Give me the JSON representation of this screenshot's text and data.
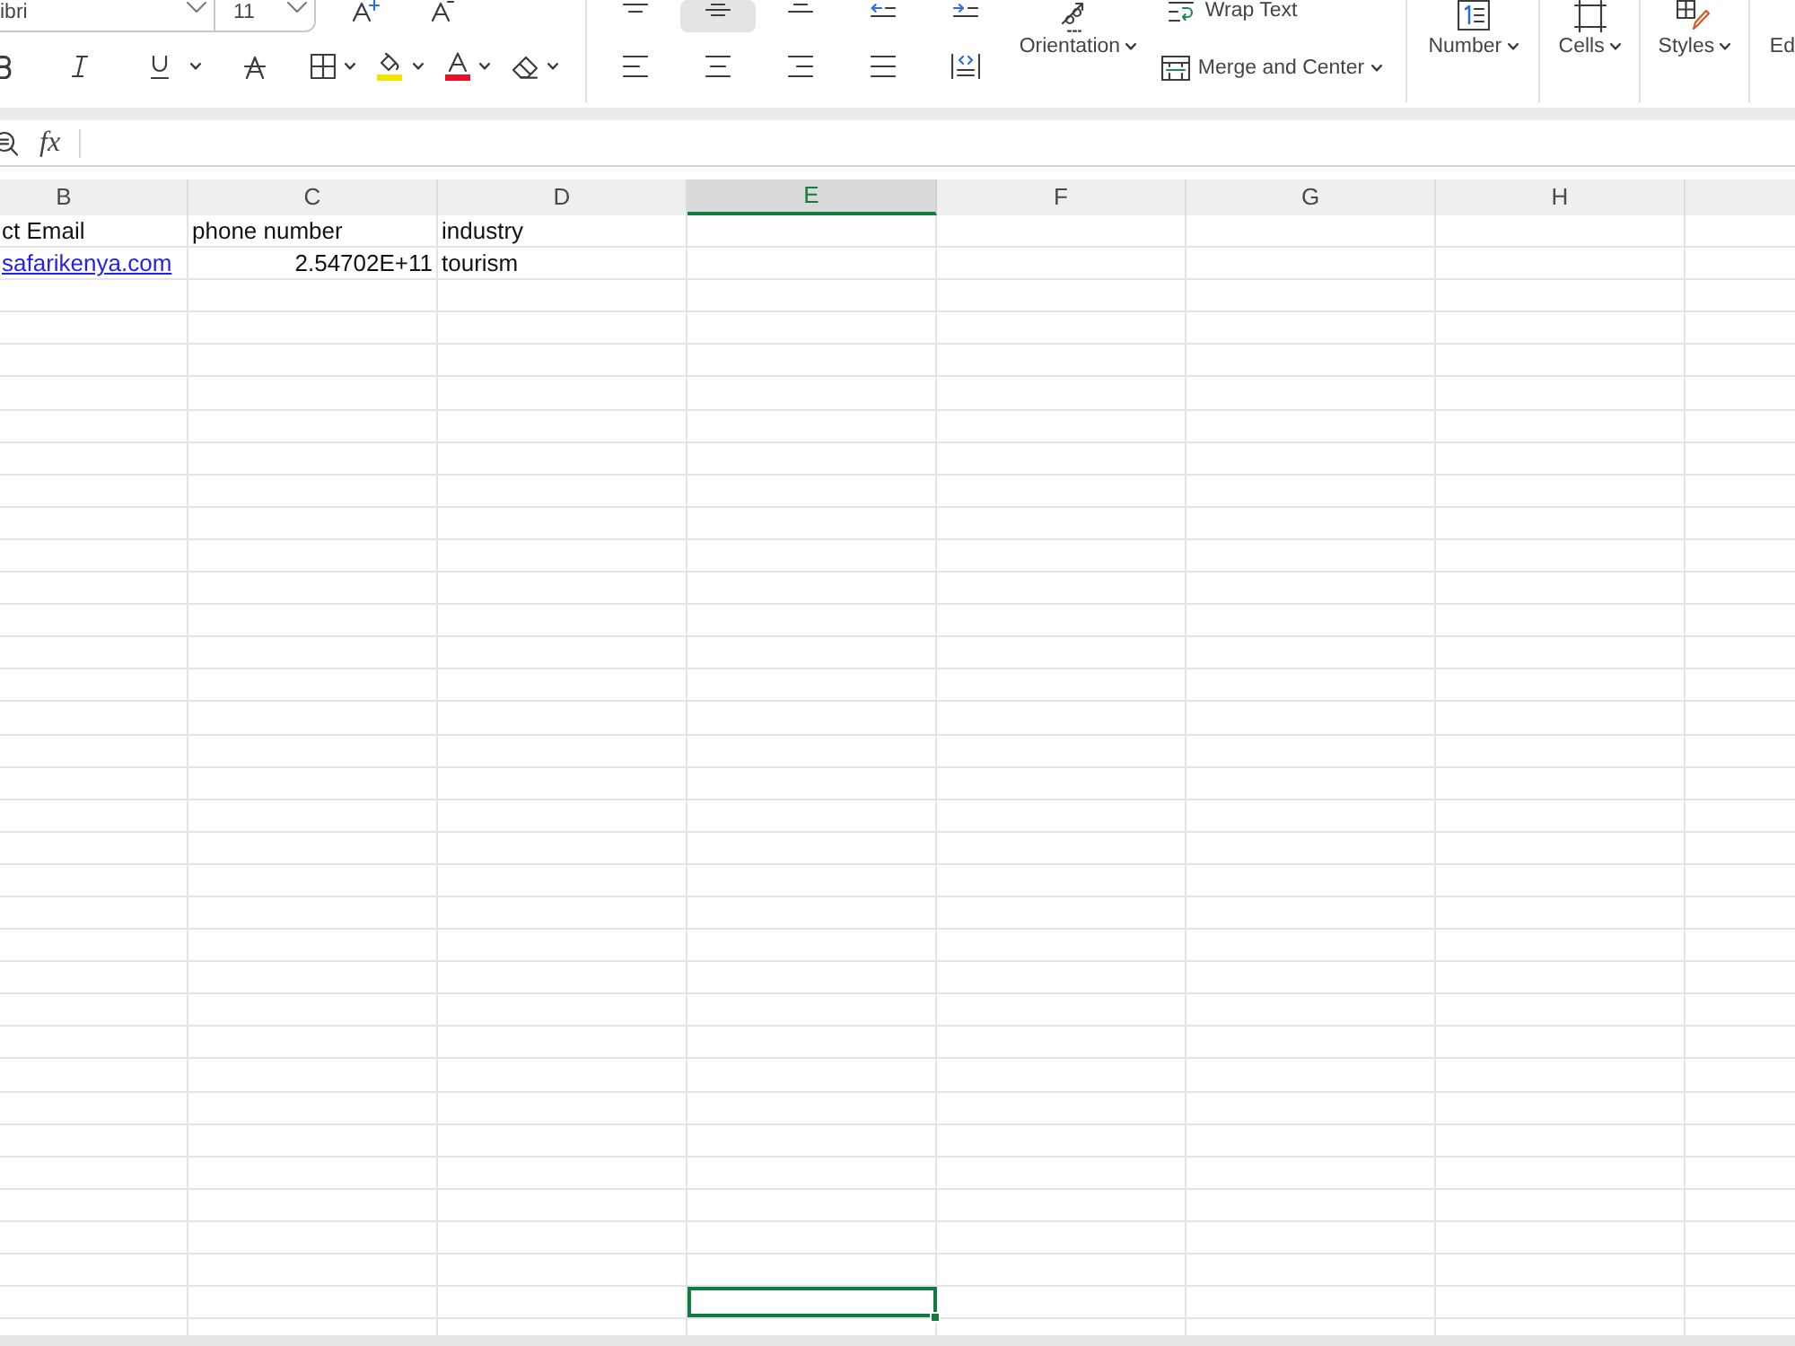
{
  "ribbon": {
    "font_name": "ibri",
    "font_size": "11",
    "vertical_alignment": [
      {
        "kind": "top",
        "selected": false
      },
      {
        "kind": "middle",
        "selected": true
      },
      {
        "kind": "bottom",
        "selected": false
      }
    ],
    "horizontal_alignment": [
      {
        "kind": "left",
        "selected": false
      },
      {
        "kind": "center",
        "selected": false
      },
      {
        "kind": "right",
        "selected": false
      },
      {
        "kind": "justify",
        "selected": false
      },
      {
        "kind": "distributed",
        "selected": false
      }
    ],
    "orientation": "Orientation",
    "wrap_text": "Wrap Text",
    "merge": "Merge and Center",
    "groups": [
      {
        "kind": "number",
        "label": "Number"
      },
      {
        "kind": "cells",
        "label": "Cells"
      },
      {
        "kind": "styles",
        "label": "Styles"
      },
      {
        "kind": "editing",
        "label": "Ed"
      }
    ]
  },
  "formula_bar": {
    "function_label": "fx"
  },
  "sheet": {
    "columns": [
      {
        "label": "B",
        "selected": false
      },
      {
        "label": "C",
        "selected": false
      },
      {
        "label": "D",
        "selected": false
      },
      {
        "label": "E",
        "selected": true
      },
      {
        "label": "F",
        "selected": false
      },
      {
        "label": "G",
        "selected": false
      },
      {
        "label": "H",
        "selected": false
      }
    ],
    "rows": [
      {
        "selected": false,
        "cells": [
          {
            "kind": "text",
            "text": "ct Email"
          },
          {
            "kind": "text",
            "text": "phone number"
          },
          {
            "kind": "text",
            "text": "industry"
          }
        ]
      },
      {
        "selected": false,
        "cells": [
          {
            "kind": "link",
            "text": "safarikenya.com"
          },
          {
            "kind": "number",
            "text": "2.54702E+11"
          },
          {
            "kind": "text",
            "text": "tourism"
          }
        ]
      },
      {
        "selected": false
      },
      {
        "selected": false
      },
      {
        "selected": false
      },
      {
        "selected": false
      },
      {
        "selected": false
      },
      {
        "selected": false
      },
      {
        "selected": false
      },
      {
        "selected": false
      },
      {
        "selected": false
      },
      {
        "selected": false
      },
      {
        "selected": false
      },
      {
        "selected": false
      },
      {
        "selected": false
      },
      {
        "selected": false
      },
      {
        "selected": false
      },
      {
        "selected": false
      },
      {
        "selected": false
      },
      {
        "selected": false
      },
      {
        "selected": false
      },
      {
        "selected": false
      },
      {
        "selected": false
      },
      {
        "selected": false
      },
      {
        "selected": false
      },
      {
        "selected": false
      },
      {
        "selected": false
      },
      {
        "selected": false
      },
      {
        "selected": false
      },
      {
        "selected": false
      },
      {
        "selected": false
      },
      {
        "selected": false
      },
      {
        "selected": false
      },
      {
        "selected": true
      },
      {
        "selected": false
      }
    ]
  }
}
